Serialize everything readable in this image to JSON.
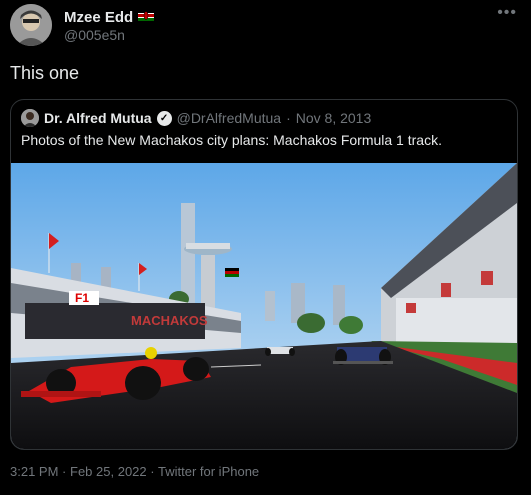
{
  "author": {
    "name": "Mzee Edd",
    "handle": "@005e5n"
  },
  "menu_icon": "more-icon",
  "tweet_text": "This one",
  "quoted": {
    "name": "Dr. Alfred Mutua",
    "handle": "@DrAlfredMutua",
    "separator": "·",
    "date": "Nov 8, 2013",
    "text": "Photos of the New Machakos city plans: Machakos Formula 1 track.",
    "image_banner": "MACHAKOS"
  },
  "meta": {
    "time": "3:21 PM",
    "separator": "·",
    "date": "Feb 25, 2022",
    "separator2": "·",
    "client": "Twitter for iPhone"
  },
  "colors": {
    "background": "#000000",
    "text": "#e7e9ea",
    "muted": "#71767b",
    "border": "#2f3336"
  }
}
